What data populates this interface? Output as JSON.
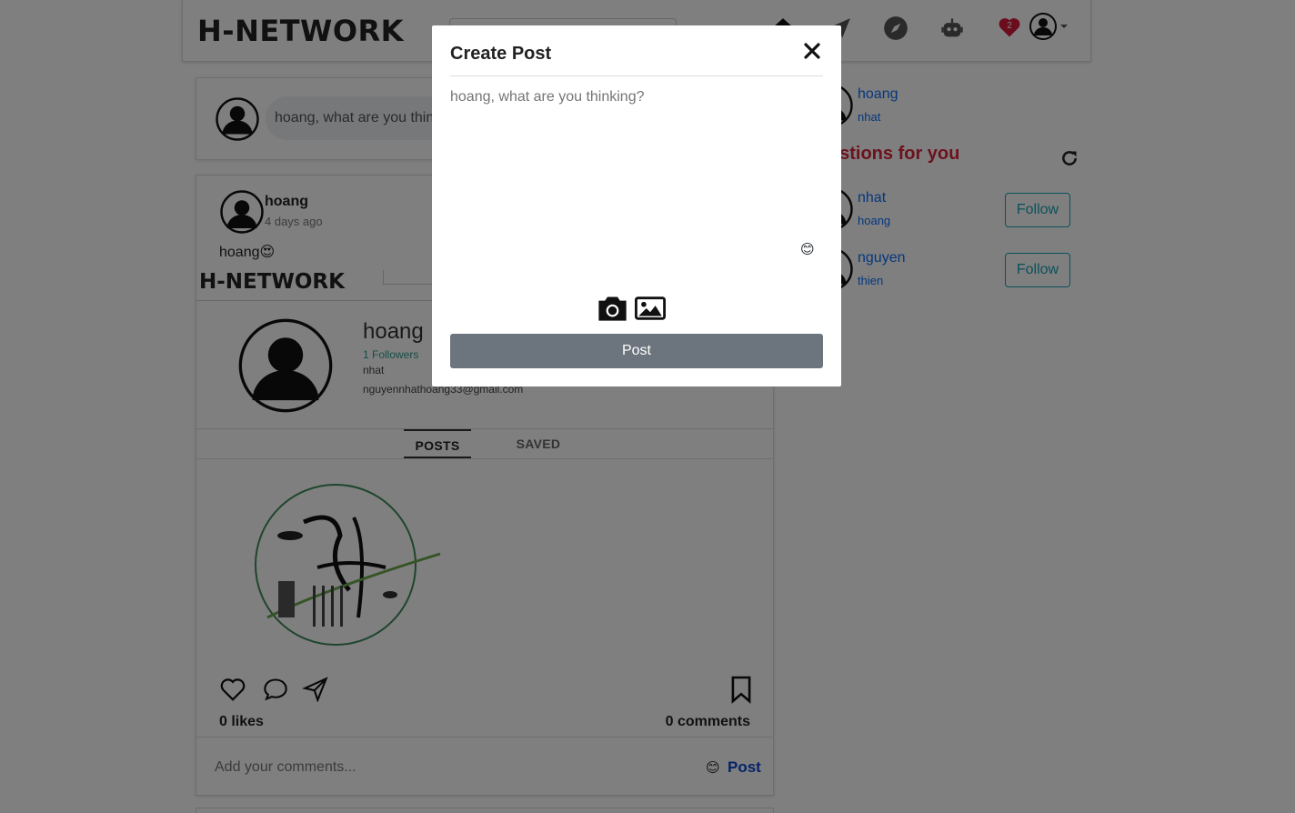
{
  "header": {
    "logo": "H-NETWORK",
    "notification_count": "2"
  },
  "status": {
    "placeholder": "hoang, what are you thinking?"
  },
  "post": {
    "author": "hoang",
    "time": "4 days ago",
    "caption": "hoang",
    "caption_emoji": "😍",
    "embedded_logo": "H-NETWORK",
    "profile_name": "hoang",
    "profile_followers": "1 Followers",
    "profile_sub": "nhat",
    "profile_email": "nguyennhathoang33@gmail.com",
    "tabs": [
      "POSTS",
      "SAVED"
    ],
    "likes": "0 likes",
    "comments": "0 comments",
    "comment_placeholder": "Add your comments...",
    "comment_emoji": "😊",
    "comment_post_label": "Post"
  },
  "sidebar": {
    "current_user": {
      "name": "hoang",
      "sub": "nhat"
    },
    "suggestions_title": "Suggestions for you",
    "suggestions": [
      {
        "name": "nhat",
        "sub": "hoang",
        "button": "Follow"
      },
      {
        "name": "nguyen",
        "sub": "thien",
        "button": "Follow"
      }
    ]
  },
  "modal": {
    "title": "Create Post",
    "placeholder": "hoang, what are you thinking?",
    "emoji": "😊",
    "post_button": "Post"
  },
  "colors": {
    "overlay": "rgba(0,0,0,0.5)",
    "post_button_bg": "#6c757d",
    "suggest_title": "#d9243a",
    "follow_border": "#17a2b8",
    "heart": "#d81b3b"
  }
}
